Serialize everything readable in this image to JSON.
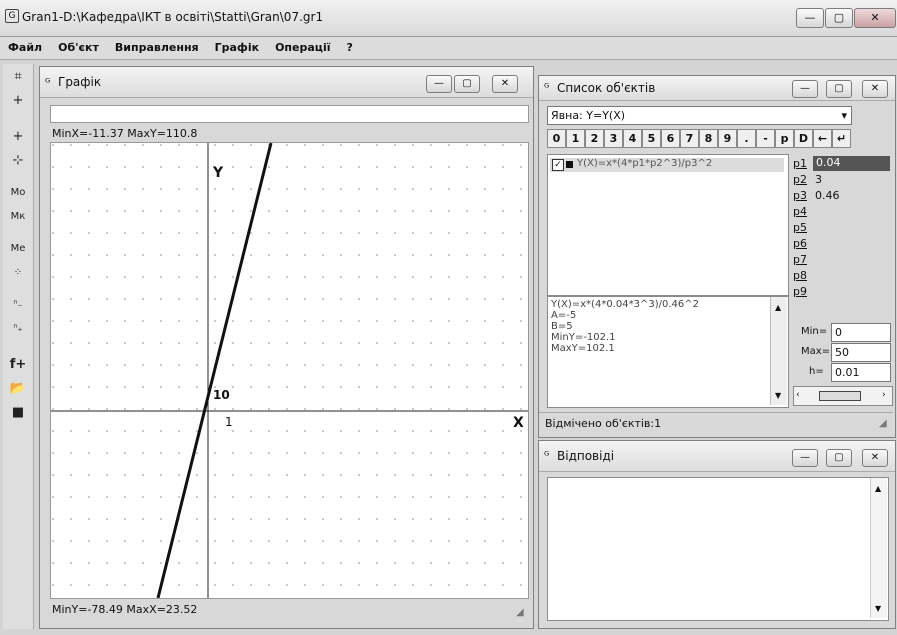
{
  "app": {
    "title": "Gran1-D:\\Кафедра\\ІКТ в освіті\\Statti\\Gran\\07.gr1"
  },
  "window_buttons": {
    "min": "—",
    "max": "▢",
    "close": "✕"
  },
  "menu": [
    "Файл",
    "Об'єкт",
    "Виправлення",
    "Графік",
    "Операції",
    "?"
  ],
  "graph_window": {
    "title": "Графік",
    "top_info": "MinX=-11.37  MaxY=110.8",
    "bottom_info": "MinY=-78.49  MaxX=23.52",
    "axis_y": "Y",
    "axis_x": "X",
    "tick_y": "10",
    "tick_x": "1"
  },
  "objects_window": {
    "title": "Список об'єктів",
    "type_select": "Явна: Y=Y(X)",
    "keypad": [
      "0",
      "1",
      "2",
      "3",
      "4",
      "5",
      "6",
      "7",
      "8",
      "9",
      ".",
      "-",
      "p",
      "D",
      "←",
      "↵"
    ],
    "function_item": "Y(X)=x*(4*p1*p2^3)/p3^2",
    "params": [
      {
        "name": "p1",
        "value": "0.04"
      },
      {
        "name": "p2",
        "value": "3"
      },
      {
        "name": "p3",
        "value": "0.46"
      },
      {
        "name": "p4",
        "value": ""
      },
      {
        "name": "p5",
        "value": ""
      },
      {
        "name": "p6",
        "value": ""
      },
      {
        "name": "p7",
        "value": ""
      },
      {
        "name": "p8",
        "value": ""
      },
      {
        "name": "p9",
        "value": ""
      }
    ],
    "info_lines": [
      "Y(X)=x*(4*0.04*3^3)/0.46^2",
      "A=-5",
      "B=5",
      "MinY=-102.1",
      "MaxY=102.1"
    ],
    "min_label": "Min=",
    "min_value": "0",
    "max_label": "Max=",
    "max_value": "50",
    "h_label": "h=",
    "h_value": "0.01",
    "status": "Відмічено об'єктів:1"
  },
  "answers_window": {
    "title": "Відповіді"
  },
  "toolbar_icons": [
    "grid-cross-icon",
    "axis-plus-icon",
    "add-point-icon",
    "cross-point-icon",
    "mo-icon",
    "mk-icon",
    "me-icon",
    "scatter-icon",
    "n-minus-icon",
    "n-plus-icon",
    "function-icon",
    "open-folder-icon",
    "save-disk-icon"
  ]
}
